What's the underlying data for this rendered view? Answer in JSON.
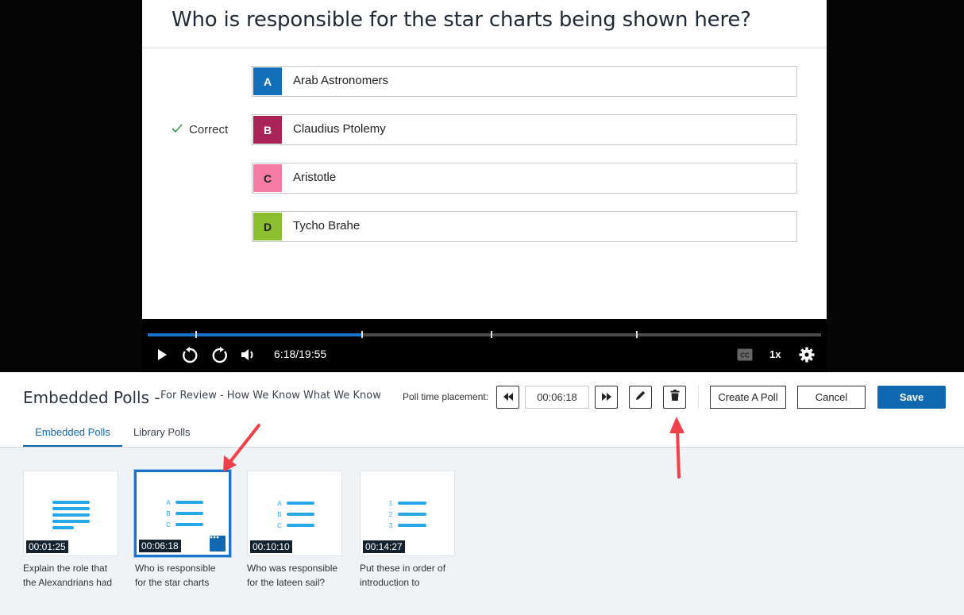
{
  "slide": {
    "question": "Who is responsible for the star charts being shown here?",
    "correct_label": "Correct",
    "answers": [
      {
        "letter": "A",
        "text": "Arab Astronomers",
        "color": "#1170b8"
      },
      {
        "letter": "B",
        "text": "Claudius Ptolemy",
        "color": "#a82356"
      },
      {
        "letter": "C",
        "text": "Aristotle",
        "color": "#f57ca4"
      },
      {
        "letter": "D",
        "text": "Tycho Brahe",
        "color": "#8cbf2f"
      }
    ]
  },
  "player": {
    "time": "6:18/19:55",
    "progress": 0.317,
    "cue_points": [
      0.071,
      0.317,
      0.51,
      0.725
    ],
    "speed": "1x",
    "icons": [
      "play-icon",
      "rewind-icon",
      "forward-icon",
      "volume-icon",
      "captions-icon",
      "settings-icon"
    ]
  },
  "editor": {
    "title": "Embedded Polls -",
    "subtitle": "For Review - How We Know What We Know",
    "placement_label": "Poll time placement:",
    "placement_time": "00:06:18",
    "create_label": "Create A Poll",
    "cancel_label": "Cancel",
    "save_label": "Save",
    "tabs": [
      "Embedded Polls",
      "Library Polls"
    ],
    "accent": "#0f68b0"
  },
  "polls": [
    {
      "time": "00:01:25",
      "label_line1": "Explain the role that",
      "label_line2": "the Alexandrians had",
      "kind": "open-text"
    },
    {
      "time": "00:06:18",
      "label_line1": "Who is responsible",
      "label_line2": "for the star charts",
      "kind": "multiple-choice",
      "selected": true
    },
    {
      "time": "00:10:10",
      "label_line1": "Who was responsible",
      "label_line2": "for the lateen sail?",
      "kind": "multiple-choice"
    },
    {
      "time": "00:14:27",
      "label_line1": "Put these in order of",
      "label_line2": "introduction to",
      "kind": "ordering"
    }
  ],
  "card_glyphs": {
    "abc": [
      "A",
      "B",
      "C"
    ],
    "numbers": [
      "1",
      "2",
      "3"
    ]
  }
}
